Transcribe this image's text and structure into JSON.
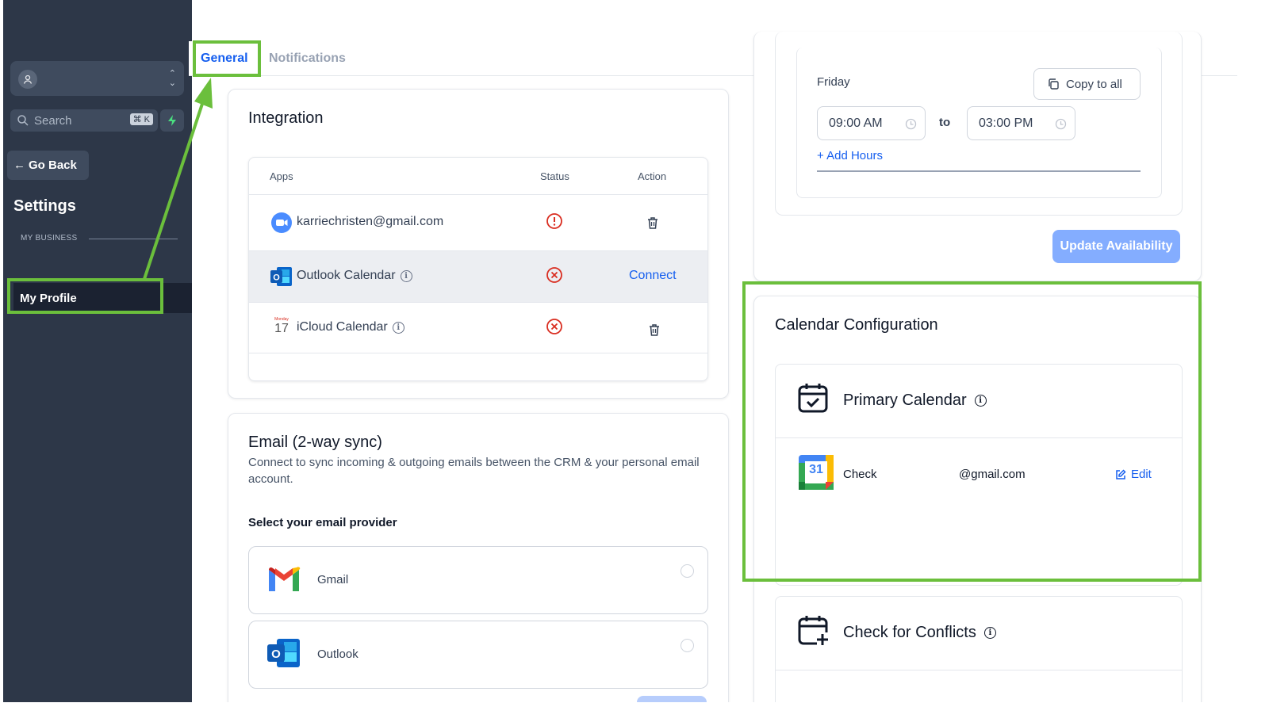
{
  "sidebar": {
    "search_placeholder": "Search",
    "search_shortcut": "⌘ K",
    "go_back": "Go Back",
    "title": "Settings",
    "section_label": "MY BUSINESS",
    "active_item": "My Profile"
  },
  "tabs": [
    {
      "label": "General",
      "active": true
    },
    {
      "label": "Notifications",
      "active": false
    }
  ],
  "integration": {
    "title": "Integration",
    "columns": [
      "Apps",
      "Status",
      "Action"
    ],
    "rows": [
      {
        "app": "karriechristen@gmail.com",
        "icon": "zoom-icon",
        "status": "warning",
        "action": "delete"
      },
      {
        "app": "Outlook Calendar",
        "icon": "outlook-icon",
        "status": "error",
        "action": "Connect"
      },
      {
        "app": "iCloud Calendar",
        "icon": "icloud-calendar-icon",
        "icon_text": "17",
        "status": "error",
        "action": "delete"
      }
    ]
  },
  "email_sync": {
    "title": "Email (2-way sync)",
    "description": "Connect to sync incoming & outgoing emails between the CRM & your personal email account.",
    "provider_label": "Select your email provider",
    "providers": [
      "Gmail",
      "Outlook"
    ]
  },
  "availability": {
    "day": "Friday",
    "copy_to_all": "Copy to all",
    "start_time": "09:00 AM",
    "to_label": "to",
    "end_time": "03:00 PM",
    "add_hours": "+ Add Hours",
    "update_button": "Update Availability"
  },
  "calendar_config": {
    "title": "Calendar Configuration",
    "primary_title": "Primary Calendar",
    "primary_row": {
      "label": "Check",
      "email": "@gmail.com",
      "edit": "Edit",
      "icon_text": "31"
    },
    "conflicts_title": "Check for Conflicts"
  },
  "colors": {
    "accent": "#155eef",
    "sidebar_bg": "#2d3748",
    "annotation_green": "#6bbf3c",
    "error_red": "#d92d20"
  }
}
